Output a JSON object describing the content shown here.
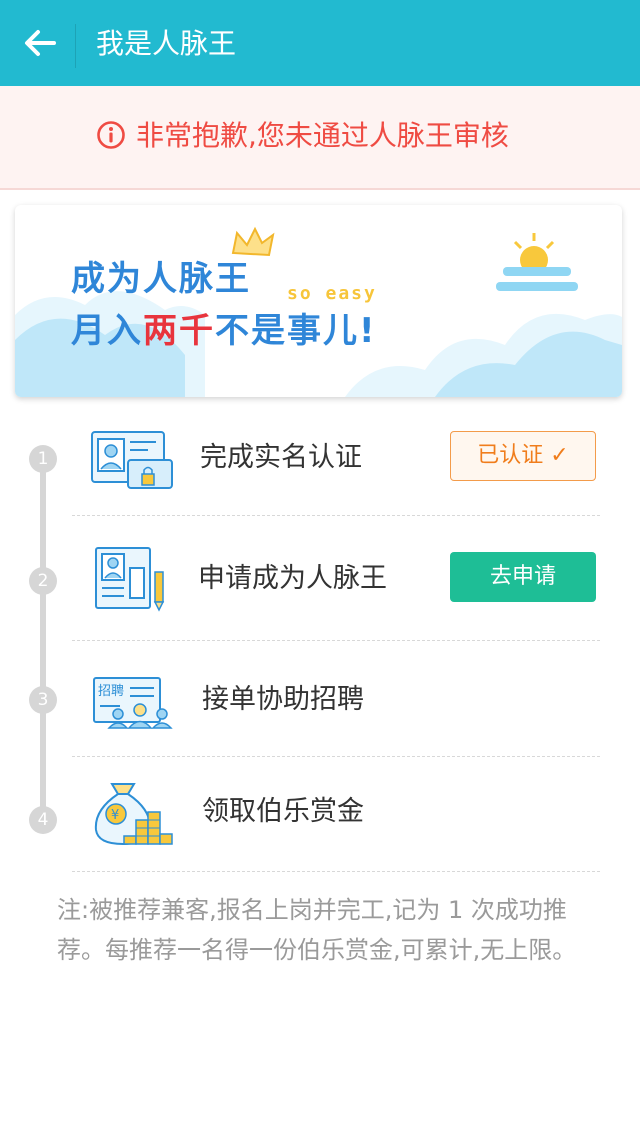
{
  "header": {
    "title": "我是人脉王",
    "back_icon": "arrow-left-icon"
  },
  "alert": {
    "text": "非常抱歉,您未通过人脉王审核",
    "icon": "info-circle-icon",
    "color": "#ef4b43"
  },
  "banner": {
    "line1": "成为人脉王",
    "line2_a": "月入",
    "line2_highlight": "两千",
    "line2_b": "不是事儿!",
    "tagline": "so easy"
  },
  "steps": [
    {
      "num": "1",
      "label": "完成实名认证",
      "icon": "id-card-icon"
    },
    {
      "num": "2",
      "label": "申请成为人脉王",
      "icon": "application-form-icon"
    },
    {
      "num": "3",
      "label": "接单协助招聘",
      "icon": "recruitment-icon",
      "icon_text": "招聘"
    },
    {
      "num": "4",
      "label": "领取伯乐赏金",
      "icon": "money-bag-icon",
      "icon_text": "¥"
    }
  ],
  "actions": {
    "certified_label": "已认证",
    "apply_label": "去申请"
  },
  "note": "注:被推荐兼客,报名上岗并完工,记为 1 次成功推荐。每推荐一名得一份伯乐赏金,可累计,无上限。",
  "colors": {
    "header": "#22bad0",
    "accent_green": "#1ebe96",
    "accent_orange": "#f07d1c"
  }
}
